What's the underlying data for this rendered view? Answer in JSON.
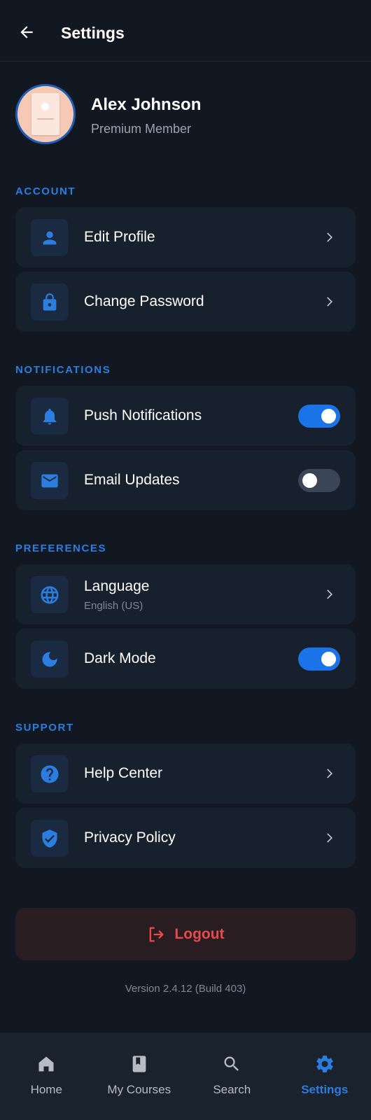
{
  "header": {
    "title": "Settings"
  },
  "profile": {
    "name": "Alex Johnson",
    "membership": "Premium Member"
  },
  "sections": {
    "account": {
      "label": "ACCOUNT",
      "items": [
        {
          "label": "Edit Profile",
          "icon": "person-icon"
        },
        {
          "label": "Change Password",
          "icon": "lock-icon"
        }
      ]
    },
    "notifications": {
      "label": "NOTIFICATIONS",
      "items": [
        {
          "label": "Push Notifications",
          "icon": "bell-icon",
          "enabled": true
        },
        {
          "label": "Email Updates",
          "icon": "mail-icon",
          "enabled": false
        }
      ]
    },
    "preferences": {
      "label": "PREFERENCES",
      "items": [
        {
          "label": "Language",
          "value": "English (US)",
          "icon": "globe-icon"
        },
        {
          "label": "Dark Mode",
          "icon": "moon-icon",
          "enabled": true
        }
      ]
    },
    "support": {
      "label": "SUPPORT",
      "items": [
        {
          "label": "Help Center",
          "icon": "help-icon"
        },
        {
          "label": "Privacy Policy",
          "icon": "shield-icon"
        }
      ]
    }
  },
  "logout": {
    "label": "Logout"
  },
  "version": "Version 2.4.12 (Build 403)",
  "bottom_nav": {
    "items": [
      {
        "label": "Home",
        "icon": "home-icon",
        "active": false
      },
      {
        "label": "My Courses",
        "icon": "book-icon",
        "active": false
      },
      {
        "label": "Search",
        "icon": "search-icon",
        "active": false
      },
      {
        "label": "Settings",
        "icon": "gear-icon",
        "active": true
      }
    ]
  },
  "colors": {
    "background": "#111822",
    "card": "#17212e",
    "accent": "#1a73e8",
    "danger": "#e64a4a"
  }
}
